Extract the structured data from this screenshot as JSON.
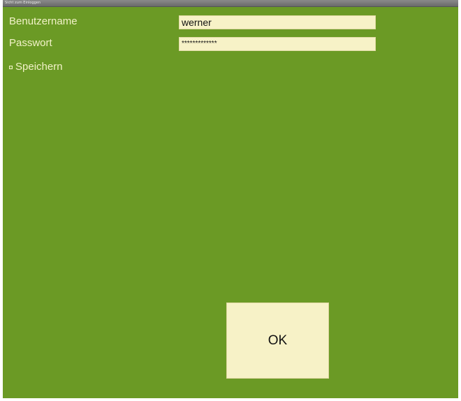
{
  "window": {
    "title": "Sicht zum Einloggen"
  },
  "form": {
    "username_label": "Benutzername",
    "username_value": "werner",
    "password_label": "Passwort",
    "password_value": "*************",
    "save_label": "Speichern",
    "save_checked": false
  },
  "actions": {
    "ok_label": "OK"
  },
  "colors": {
    "background": "#6b9a25",
    "field_background": "#f7f2c7",
    "label_text": "#f2f2c8"
  }
}
